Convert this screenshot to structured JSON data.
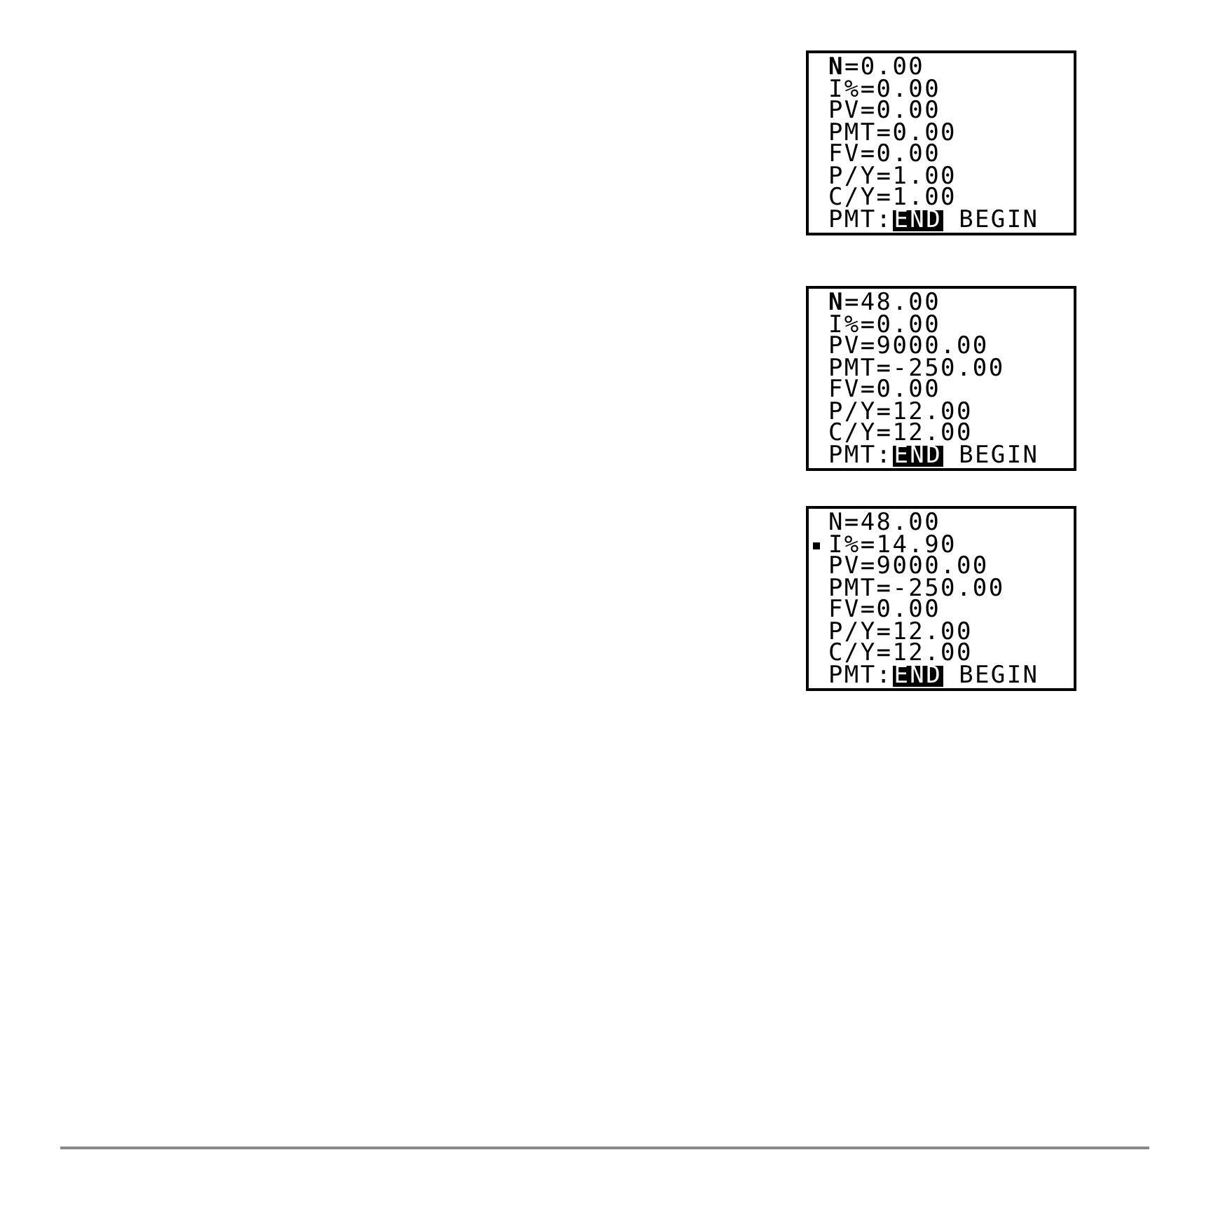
{
  "screens": [
    {
      "lines": [
        {
          "text": "N=0.00",
          "cursor": true,
          "solved": false
        },
        {
          "text": "I%=0.00",
          "cursor": false,
          "solved": false
        },
        {
          "text": "PV=0.00",
          "cursor": false,
          "solved": false
        },
        {
          "text": "PMT=0.00",
          "cursor": false,
          "solved": false
        },
        {
          "text": "FV=0.00",
          "cursor": false,
          "solved": false
        },
        {
          "text": "P/Y=1.00",
          "cursor": false,
          "solved": false
        },
        {
          "text": "C/Y=1.00",
          "cursor": false,
          "solved": false
        }
      ],
      "payment": {
        "label": "PMT:",
        "options": [
          {
            "label": "END",
            "selected": true
          },
          {
            "label": "BEGIN",
            "selected": false
          }
        ]
      }
    },
    {
      "lines": [
        {
          "text": "N=48.00",
          "cursor": true,
          "solved": false
        },
        {
          "text": "I%=0.00",
          "cursor": false,
          "solved": false
        },
        {
          "text": "PV=9000.00",
          "cursor": false,
          "solved": false
        },
        {
          "text": "PMT=-250.00",
          "cursor": false,
          "solved": false
        },
        {
          "text": "FV=0.00",
          "cursor": false,
          "solved": false
        },
        {
          "text": "P/Y=12.00",
          "cursor": false,
          "solved": false
        },
        {
          "text": "C/Y=12.00",
          "cursor": false,
          "solved": false
        }
      ],
      "payment": {
        "label": "PMT:",
        "options": [
          {
            "label": "END",
            "selected": true
          },
          {
            "label": "BEGIN",
            "selected": false
          }
        ]
      }
    },
    {
      "lines": [
        {
          "text": "N=48.00",
          "cursor": false,
          "solved": false
        },
        {
          "text": "I%=14.90",
          "cursor": false,
          "solved": true
        },
        {
          "text": "PV=9000.00",
          "cursor": false,
          "solved": false
        },
        {
          "text": "PMT=-250.00",
          "cursor": false,
          "solved": false
        },
        {
          "text": "FV=0.00",
          "cursor": false,
          "solved": false
        },
        {
          "text": "P/Y=12.00",
          "cursor": false,
          "solved": false
        },
        {
          "text": "C/Y=12.00",
          "cursor": false,
          "solved": false
        }
      ],
      "payment": {
        "label": "PMT:",
        "options": [
          {
            "label": "END",
            "selected": true
          },
          {
            "label": "BEGIN",
            "selected": false
          }
        ]
      }
    }
  ]
}
